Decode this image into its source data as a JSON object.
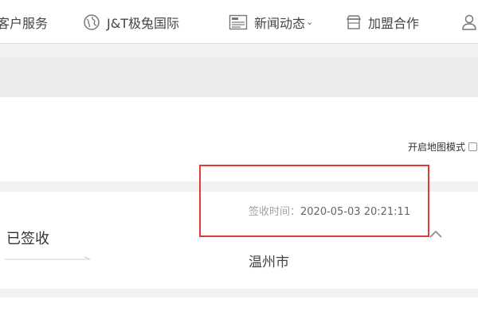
{
  "nav": {
    "service": "客户服务",
    "intl": "J&T极兔国际",
    "news": "新闻动态",
    "news_chevron": "⌄",
    "join": "加盟合作"
  },
  "map_toggle": {
    "label": "开启地图模式"
  },
  "tracking": {
    "status": "已签收",
    "sign_label": "签收时间：",
    "sign_time": "2020-05-03 20:21:11",
    "city": "温州市"
  },
  "colors": {
    "highlight": "#e03b3b"
  }
}
